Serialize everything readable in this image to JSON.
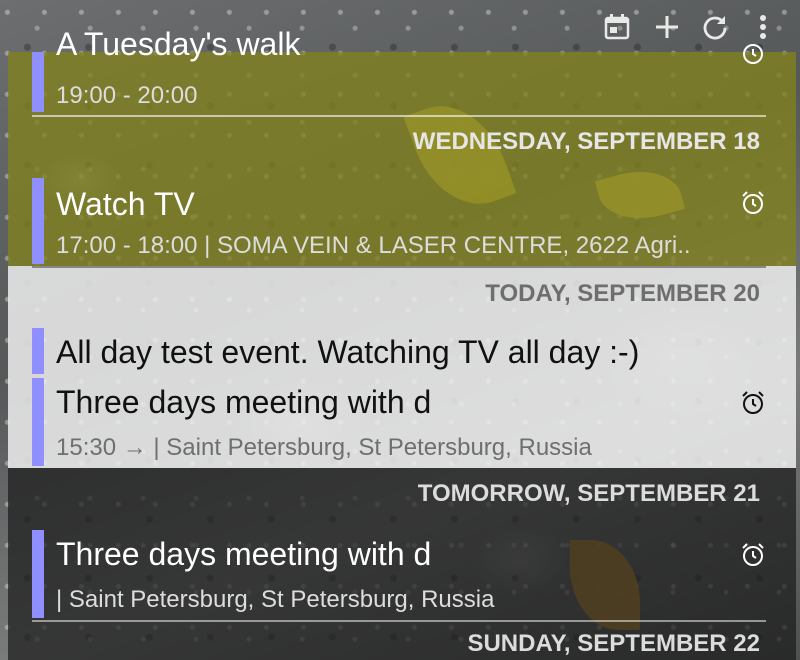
{
  "toolbar": {
    "icons": [
      "calendar-today-icon",
      "add-icon",
      "refresh-icon",
      "more-vert-icon"
    ]
  },
  "events": [
    {
      "title": "A Tuesday's walk",
      "time": "19:00 - 20:00"
    },
    {
      "title": "Watch TV",
      "time": "17:00 - 18:00  |  SOMA VEIN & LASER CENTRE, 2622 Agri.."
    },
    {
      "title": "All day test event. Watching TV all day :-)"
    },
    {
      "title": "Three days meeting with d",
      "time": "15:30 →  |  Saint Petersburg, St Petersburg, Russia"
    },
    {
      "title": "Three days meeting with d",
      "time": " |  Saint Petersburg, St Petersburg, Russia"
    }
  ],
  "days": {
    "wednesday": "WEDNESDAY, SEPTEMBER 18",
    "today": "TODAY, SEPTEMBER 20",
    "tomorrow": "TOMORROW, SEPTEMBER 21",
    "sunday": "SUNDAY, SEPTEMBER 22"
  },
  "colors": {
    "event_bar": "#8f8fff",
    "past_panel": "#81811e",
    "today_panel": "#eeeeee",
    "future_panel": "#1c1c1c"
  }
}
